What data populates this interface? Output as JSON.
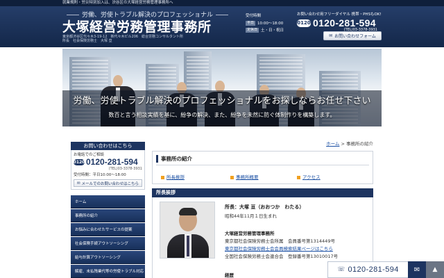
{
  "header": {
    "top_strip": "就業規則・労災特別加入は、渋谷区の大塚経営労務管理事務所へ",
    "tagline": "労働、労使トラブル解決のプロフェッショナル",
    "logo": "大塚経営労務管理事務所",
    "address_line1": "東京都渋谷区代々木3-19-12　新代々木ビル206　総合労務コンサルタント所",
    "address_line2": "所長　社会保険労務士　大塚 亘",
    "hours_title": "受付時間",
    "weekday_tag": "平日",
    "weekday_hours": "10:00～18:00",
    "holiday_tag": "定休日",
    "holiday_text": "土・日・祝日",
    "contact_title": "お問い合わせ用フリーダイヤル 携帯・PHSもOK!",
    "tel_icon": "free-dial-icon",
    "tel_icon_text": "0120",
    "tel": "0120-281-594",
    "tel_sub": "(TEL)03-3378-3931",
    "contact_button": "お問い合わせフォーム"
  },
  "hero": {
    "title": "労働、労使トラブル解決のプロフェッショナルをお探しならお任せ下さい",
    "subtitle": "数百と言う相談実績を基に、紛争の解決、また、紛争を未然に防ぐ体制作りを構築します。"
  },
  "sidebar": {
    "contact_head": "お問い合わせはこちら",
    "phone_label": "お電話でのご相談",
    "tel": "0120-281-594",
    "tel_sub": "(TEL)03-3378-3931",
    "hours": "受付時間：平日10:00～18:00",
    "mail_button": "メールでのお問い合わせはこちら",
    "nav": [
      {
        "label": "ホーム"
      },
      {
        "label": "事務所の紹介"
      },
      {
        "label": "お悩みに合わせたサービスの提案"
      },
      {
        "label": "社会保険手続アウトソーシング"
      },
      {
        "label": "給与計算アウトソーシング"
      },
      {
        "label": "解雇、未払残業代等の労使トラブル対応"
      }
    ]
  },
  "breadcrumb": {
    "home": "ホーム",
    "separator": " > ",
    "current": "事務所の紹介"
  },
  "intro": {
    "heading": "事務所の紹介",
    "links": [
      "所長挨拶",
      "事務所概要",
      "アクセス"
    ]
  },
  "greeting": {
    "bar_title": "所長挨拶",
    "name_line": "所長：大塚 亘（おおつか　わたる）",
    "birth": "昭和44年11月１日生まれ",
    "office_name": "大塚経営労務管理事務所",
    "member_line": "東京都社会保険労務士会所属　会員番号第1314449号",
    "search_link": "東京都社会保険労務士会会員検索結果ページはこちら",
    "registry_line": "全国社会保険労務士会連合会　登録番号第13010017号",
    "history_heading": "経歴"
  },
  "float_bar": {
    "tel": "0120-281-594",
    "tel_icon": "phone-icon",
    "mail_icon": "mail-icon",
    "top_icon": "arrow-up-icon"
  },
  "colors": {
    "navy": "#1d3460",
    "header_bg": "#1f3866",
    "link": "#1a4fa3",
    "accent": "#f0a020"
  }
}
